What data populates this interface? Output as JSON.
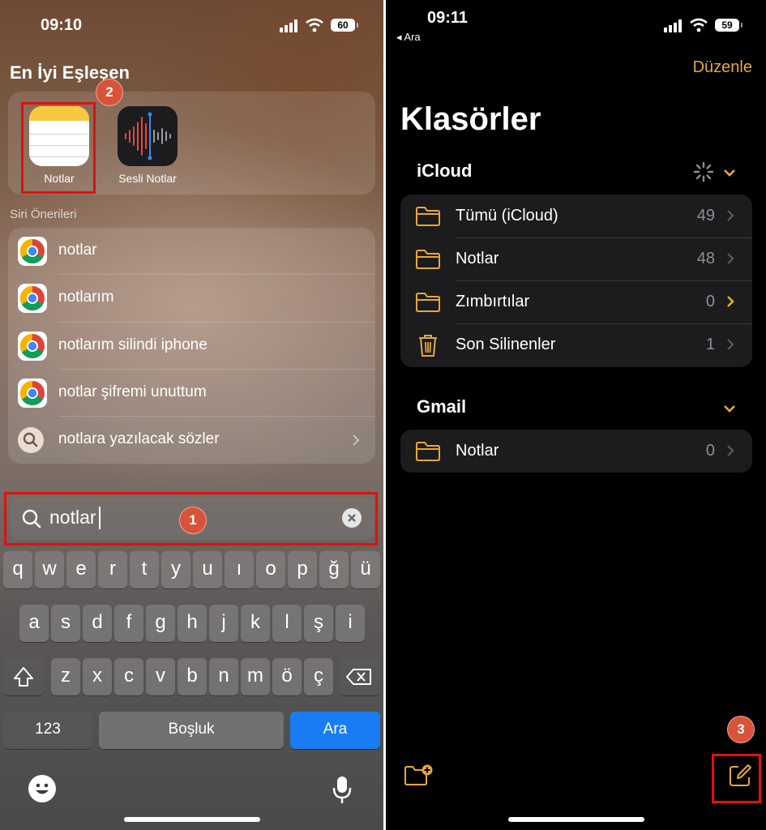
{
  "left": {
    "status": {
      "time": "09:10",
      "battery": "60"
    },
    "best_match_title": "En İyi Eşleşen",
    "apps": [
      {
        "name": "Notlar",
        "icon": "notes-app-icon"
      },
      {
        "name": "Sesli Notlar",
        "icon": "voice-memos-app-icon"
      }
    ],
    "siri_title": "Siri Önerileri",
    "suggestions": [
      {
        "label": "notlar",
        "icon": "chrome-icon"
      },
      {
        "label": "notlarım",
        "icon": "chrome-icon"
      },
      {
        "label": "notlarım silindi iphone",
        "icon": "chrome-icon"
      },
      {
        "label": "notlar şifremi unuttum",
        "icon": "chrome-icon"
      },
      {
        "label": "notlara yazılacak sözler",
        "icon": "search-icon"
      }
    ],
    "search": {
      "value": "notlar"
    },
    "keyboard": {
      "row1": [
        "q",
        "w",
        "e",
        "r",
        "t",
        "y",
        "u",
        "ı",
        "o",
        "p",
        "ğ",
        "ü"
      ],
      "row2": [
        "a",
        "s",
        "d",
        "f",
        "g",
        "h",
        "j",
        "k",
        "l",
        "ş",
        "i"
      ],
      "row3": [
        "z",
        "x",
        "c",
        "v",
        "b",
        "n",
        "m",
        "ö",
        "ç"
      ],
      "num_label": "123",
      "space_label": "Boşluk",
      "go_label": "Ara"
    },
    "badges": {
      "one": "1",
      "two": "2"
    }
  },
  "right": {
    "status": {
      "time": "09:11",
      "battery": "59",
      "back_label": "◂ Ara"
    },
    "edit_label": "Düzenle",
    "title": "Klasörler",
    "accounts": [
      {
        "name": "iCloud",
        "folders": [
          {
            "name": "Tümü (iCloud)",
            "count": "49",
            "icon": "folder-icon"
          },
          {
            "name": "Notlar",
            "count": "48",
            "icon": "folder-icon"
          },
          {
            "name": "Zımbırtılar",
            "count": "0",
            "icon": "folder-icon"
          },
          {
            "name": "Son Silinenler",
            "count": "1",
            "icon": "trash-icon"
          }
        ]
      },
      {
        "name": "Gmail",
        "folders": [
          {
            "name": "Notlar",
            "count": "0",
            "icon": "folder-icon"
          }
        ]
      }
    ],
    "badge_three": "3"
  },
  "colors": {
    "accent": "#e6a937",
    "annotation_red": "#e01010",
    "badge": "#d9533a",
    "keyboard_go": "#1a7cf5"
  }
}
